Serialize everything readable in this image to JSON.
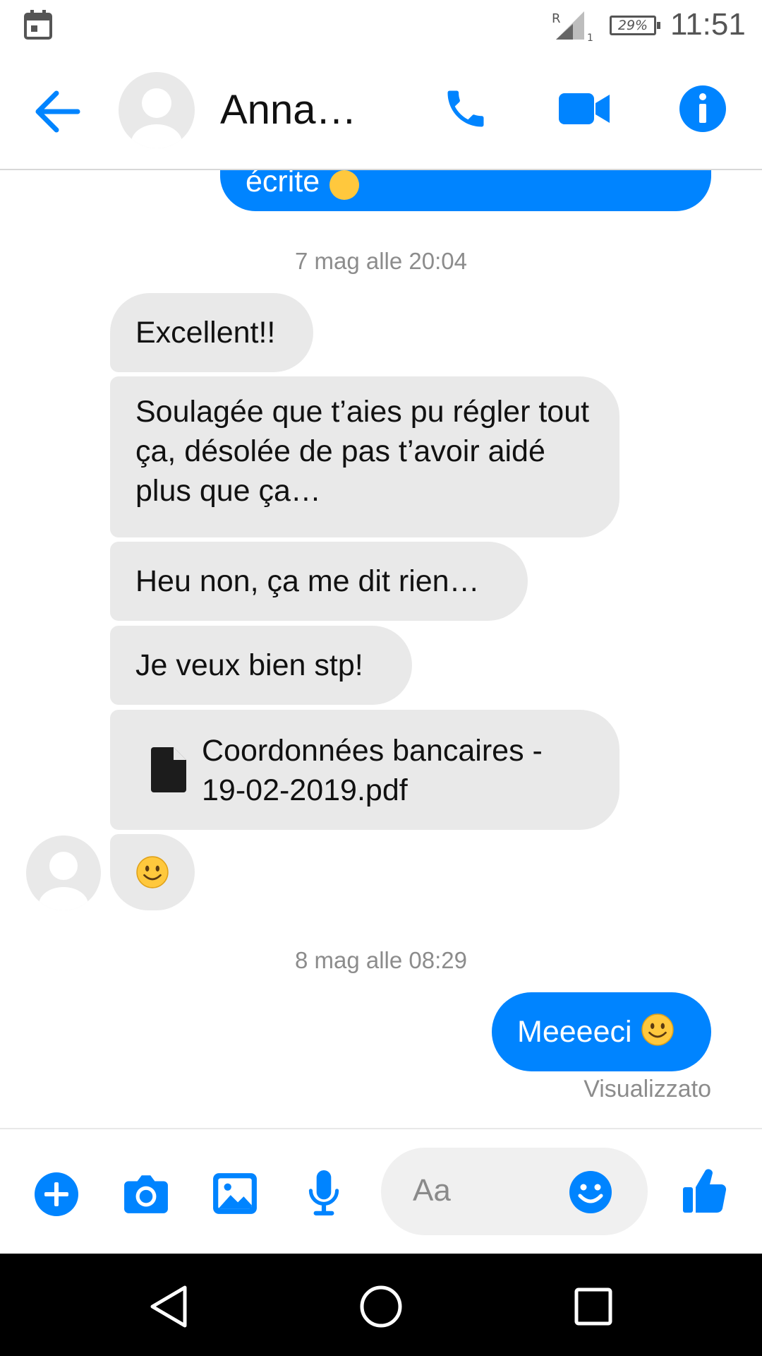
{
  "status_bar": {
    "battery": "29%",
    "time": "11:51",
    "roaming": "R",
    "sim": "1"
  },
  "header": {
    "contact_name": "Anna…"
  },
  "messages": {
    "partial_top": "écrite",
    "timestamp_1": "7 mag alle 20:04",
    "in_1": "Excellent!!",
    "in_2": "Soulagée que t’aies pu régler tout ça, désolée de pas t’avoir aidé plus que ça…",
    "in_3": "Heu non, ça me dit rien…",
    "in_4": "Je veux bien stp!",
    "file_name": "Coordonnées bancaires - 19-02-2019.pdf",
    "timestamp_2": "8 mag alle 08:29",
    "out_1": "Meeeeci",
    "seen_status": "Visualizzato"
  },
  "composer": {
    "placeholder": "Aa"
  },
  "colors": {
    "accent": "#0084ff",
    "incoming_bubble": "#e9e9e9",
    "timestamp": "#8c8c8c"
  },
  "icons": [
    "calendar-icon",
    "signal-icon",
    "battery-icon",
    "back-arrow-icon",
    "avatar-icon",
    "phone-icon",
    "video-camera-icon",
    "info-icon",
    "file-icon",
    "smiley-icon",
    "plus-icon",
    "camera-icon",
    "gallery-icon",
    "microphone-icon",
    "emoji-icon",
    "thumbs-up-icon",
    "nav-back-icon",
    "nav-home-icon",
    "nav-recents-icon"
  ]
}
